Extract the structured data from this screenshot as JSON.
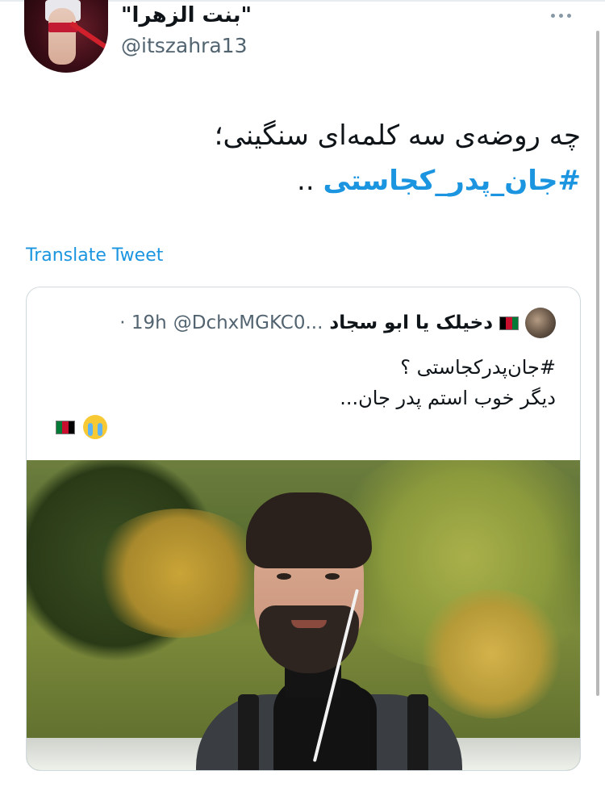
{
  "tweet": {
    "display_name": "\"بنت الزهرا\"",
    "handle": "@itszahra13",
    "text_line1": "چه روضه‌ی سه کلمه‌ای سنگینی؛",
    "hashtag": "#جان_پدر_کجاستی",
    "trailing": " ..",
    "translate_label": "Translate Tweet"
  },
  "quoted": {
    "name": "دخیلک یا ابو سجاد",
    "handle": "@DchxMGKC0...",
    "time": "· 19h",
    "line1": "#جان‌پدرکجاستی ؟",
    "line2": "دیگر خوب استم پدر جان...",
    "emoji": [
      "crying-face",
      "afghanistan-flag"
    ]
  },
  "colors": {
    "link": "#1b95e0",
    "secondary_text": "#536471",
    "border": "#cfd9de"
  }
}
